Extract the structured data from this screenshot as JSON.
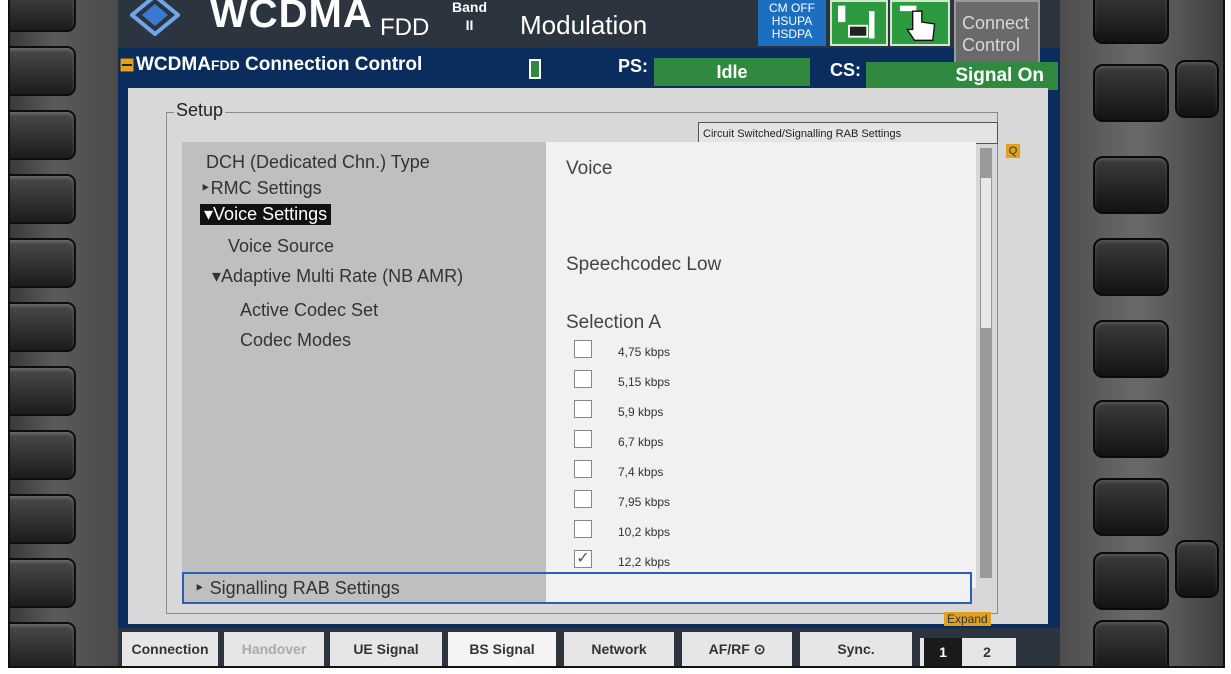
{
  "header": {
    "app_title": "WCDMA",
    "fdd": "FDD",
    "band_label": "Band",
    "band_value": "II",
    "mode": "Modulation",
    "status_lines": [
      "CM OFF",
      "HSUPA",
      "HSDPA"
    ],
    "connect_control_line1": "Connect",
    "connect_control_line2": "Control"
  },
  "panel": {
    "title_main": "WCDMA",
    "title_small": "FDD",
    "title_rest": "Connection Control",
    "ps_label": "PS:",
    "ps_value": "Idle",
    "cs_label": "CS:",
    "cs_value": "Signal On"
  },
  "setup": {
    "label": "Setup",
    "rab_tag": "Circuit Switched/Signalling RAB Settings",
    "tree": [
      "DCH (Dedicated Chn.) Type",
      "RMC Settings",
      "Voice Settings",
      "Voice Source",
      "Adaptive Multi Rate (NB AMR)",
      "Active Codec Set",
      "Codec Modes"
    ],
    "values": {
      "dch_type": "Voice",
      "voice_source": "Speechcodec Low",
      "active_codec_set": "Selection A"
    },
    "codec_modes": [
      {
        "label": "4,75 kbps",
        "checked": false
      },
      {
        "label": "5,15 kbps",
        "checked": false
      },
      {
        "label": "5,9 kbps",
        "checked": false
      },
      {
        "label": "6,7 kbps",
        "checked": false
      },
      {
        "label": "7,4 kbps",
        "checked": false
      },
      {
        "label": "7,95 kbps",
        "checked": false
      },
      {
        "label": "10,2 kbps",
        "checked": false
      },
      {
        "label": "12,2 kbps",
        "checked": true
      }
    ],
    "signalling": "Signalling RAB Settings",
    "expand": "Expand",
    "help_mark": "Q"
  },
  "tabs": [
    {
      "label": "Connection",
      "state": "normal"
    },
    {
      "label": "Handover",
      "state": "disabled"
    },
    {
      "label": "UE Signal",
      "state": "normal"
    },
    {
      "label": "BS Signal",
      "state": "active"
    },
    {
      "label": "Network",
      "state": "normal"
    },
    {
      "label": "AF/RF",
      "state": "normal"
    },
    {
      "label": "Sync.",
      "state": "normal"
    }
  ],
  "pages": [
    "1",
    "2"
  ],
  "colors": {
    "screen_bg": "#0b2d5e",
    "status_green": "#2f8a40",
    "selection_blue": "#2b5fb5",
    "highlight_orange": "#e0a020"
  }
}
